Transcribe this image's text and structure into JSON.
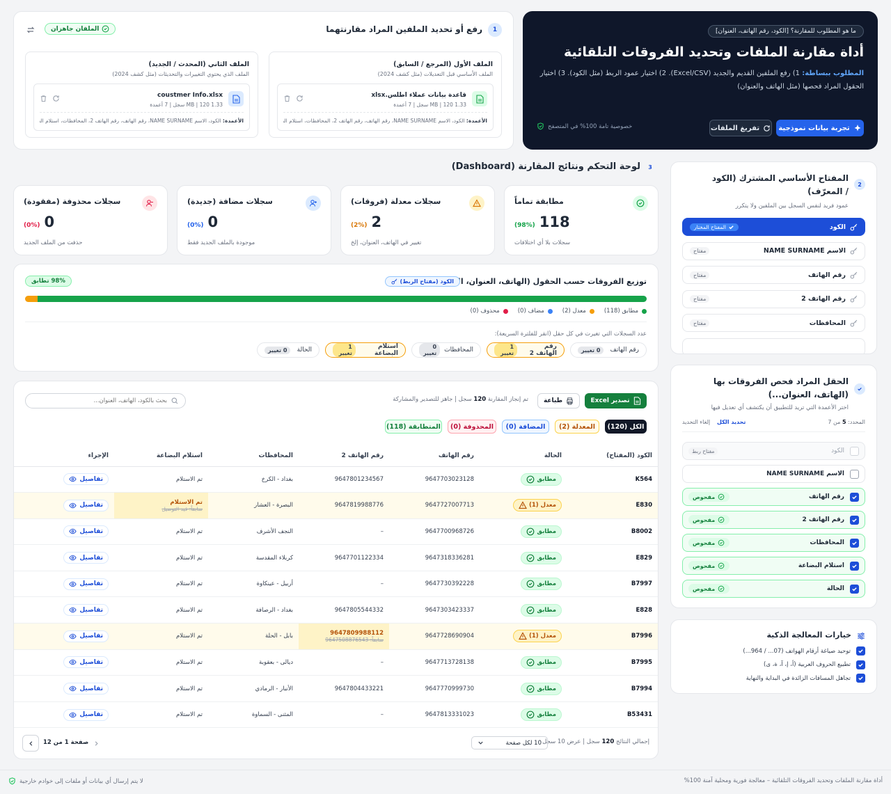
{
  "hero": {
    "question": "ما هو المطلوب للمقارنة؟ [الكود، رقم الهاتف، العنوان]",
    "title": "أداة مقارنة الملفات وتحديد الفروقات التلقائية",
    "desc_strong": "المطلوب ببساطة:",
    "desc": "1) رفع الملفين القديم والجديد (Excel/CSV). 2) اختيار عمود الربط (مثل الكود). 3) اختيار الحقول المراد فحصها (مثل الهاتف والعنوان)",
    "btn_demo": "تجربة بيانات نموذجية",
    "btn_clear": "تفريغ الملفات",
    "privacy": "خصوصية تامة 100% في المتصفح"
  },
  "upload": {
    "step": "1",
    "title": "رفع أو تحديد الملفين المراد مقارنتهما",
    "ready": "الملفان جاهزان",
    "file1": {
      "head": "الملف الأول (المرجع / السابق)",
      "sub": "الملف الأساسي قبل التعديلات (مثل كشف 2024)",
      "name": "قاعدة بيانات عملاء اطلس.xlsx",
      "meta": "1.33 MB | 120 سجل | 7 أعمدة",
      "cols_label": "الأعمدة:",
      "cols": "الكود، الاسم NAME SURNAME، رقم الهاتف، رقم الهاتف 2، المحافظات، استلام الب..."
    },
    "file2": {
      "head": "الملف الثاني (المحدث / الجديد)",
      "sub": "الملف الذي يحتوي التغييرات والتحديثات (مثل كشف 2024)",
      "name": "coustmer Info.xlsx",
      "meta": "1.33 MB | 120 سجل | 7 أعمدة",
      "cols_label": "الأعمدة:",
      "cols": "الكود، الاسم NAME SURNAME، رقم الهاتف، رقم الهاتف 2، المحافظات، استلام الب..."
    }
  },
  "dash": {
    "step": "3",
    "title": "لوحة التحكم ونتائج المقارنة (Dashboard)"
  },
  "stats": [
    {
      "title": "مطابقة تماماً",
      "num": "118",
      "pct": "(98%)",
      "desc": "سجلات بلا أي اختلافات",
      "color": "#16a34a"
    },
    {
      "title": "سجلات معدلة (فروقات)",
      "num": "2",
      "pct": "(2%)",
      "desc": "تغيير في الهاتف، العنوان، إلخ",
      "color": "#d97706"
    },
    {
      "title": "سجلات مضافة (جديدة)",
      "num": "0",
      "pct": "(0%)",
      "desc": "موجودة بالملف الجديد فقط",
      "color": "#2563eb"
    },
    {
      "title": "سجلات محذوفة (مفقودة)",
      "num": "0",
      "pct": "(0%)",
      "desc": "حذفت من الملف الجديد",
      "color": "#e11d48"
    }
  ],
  "dist": {
    "title": "توزيع الفروقات حسب الحقول (الهاتف، العنوان، الأكواد...)",
    "key_badge": "الكود (مفتاح الربط)",
    "match_badge": "98% تطابق",
    "match_frac": 0.98,
    "modified_frac": 0.02,
    "legend": [
      {
        "label": "مطابق (118)",
        "color": "#16a34a"
      },
      {
        "label": "معدل (2)",
        "color": "#f59e0b"
      },
      {
        "label": "مضاف (0)",
        "color": "#3b82f6"
      },
      {
        "label": "محذوف (0)",
        "color": "#e11d48"
      }
    ],
    "note": "عدد السجلات التي تغيرت في كل حقل (انقر للفلترة السريعة):",
    "chips": [
      {
        "label": "رقم الهاتف",
        "count": "0 تغيير",
        "hl": false
      },
      {
        "label": "رقم الهاتف 2",
        "count": "1 تغيير",
        "hl": true
      },
      {
        "label": "المحافظات",
        "count": "0 تغيير",
        "hl": false
      },
      {
        "label": "استلام البضاعة",
        "count": "1 تغيير",
        "hl": true
      },
      {
        "label": "الحالة",
        "count": "0 تغيير",
        "hl": false
      }
    ]
  },
  "table": {
    "export": "تصدير Excel",
    "print": "طباعة",
    "info_a": "تم إنجاز المقارنة",
    "info_n": "120",
    "info_b": "سجل | جاهز للتصدير والمشاركة",
    "search_ph": "بحث بالكود، الهاتف، العنوان...",
    "tabs": [
      {
        "label": "الكل (120)"
      },
      {
        "label": "المعدلة (2)"
      },
      {
        "label": "المضافة (0)"
      },
      {
        "label": "المحذوفة (0)"
      },
      {
        "label": "المتطابقة (118)"
      }
    ],
    "headers": [
      "الكود (المفتاح)",
      "الحالة",
      "رقم الهاتف",
      "رقم الهاتف 2",
      "المحافظات",
      "استلام البضاعة",
      "الإجراء"
    ],
    "rows": [
      {
        "code": "K564",
        "status": "مطابق",
        "s": "ok",
        "phone": "9647703023128",
        "phone2": "9647801234567",
        "gov": "بغداد - الكرخ",
        "recv": "تم الاستلام"
      },
      {
        "code": "E830",
        "status": "معدل (1)",
        "s": "mod",
        "phone": "9647727007713",
        "phone2": "9647819988776",
        "gov": "البصرة - العشار",
        "recv": "تم الاستلام",
        "recv_old": "سابقاً: قيد التوصيل"
      },
      {
        "code": "B8002",
        "status": "مطابق",
        "s": "ok",
        "phone": "9647700968726",
        "phone2": "–",
        "gov": "النجف الأشرف",
        "recv": "تم الاستلام"
      },
      {
        "code": "E829",
        "status": "مطابق",
        "s": "ok",
        "phone": "9647318336281",
        "phone2": "9647701122334",
        "gov": "كربلاء المقدسة",
        "recv": "تم الاستلام"
      },
      {
        "code": "B7997",
        "status": "مطابق",
        "s": "ok",
        "phone": "9647730392228",
        "phone2": "–",
        "gov": "أربيل - عينكاوة",
        "recv": "تم الاستلام"
      },
      {
        "code": "E828",
        "status": "مطابق",
        "s": "ok",
        "phone": "9647303423337",
        "phone2": "9647805544332",
        "gov": "بغداد - الرصافة",
        "recv": "تم الاستلام"
      },
      {
        "code": "B7996",
        "status": "معدل (1)",
        "s": "mod",
        "phone": "9647728690904",
        "phone2": "9647809988112",
        "phone2_old": "سابقاً: 9647508876543",
        "gov": "بابل - الحلة",
        "recv": "تم الاستلام"
      },
      {
        "code": "B7995",
        "status": "مطابق",
        "s": "ok",
        "phone": "9647713728138",
        "phone2": "–",
        "gov": "ديالى - بعقوبة",
        "recv": "تم الاستلام"
      },
      {
        "code": "B7994",
        "status": "مطابق",
        "s": "ok",
        "phone": "9647770999730",
        "phone2": "9647804433221",
        "gov": "الأنبار - الرمادي",
        "recv": "تم الاستلام"
      },
      {
        "code": "B53431",
        "status": "مطابق",
        "s": "ok",
        "phone": "9647813331023",
        "phone2": "–",
        "gov": "المثنى - السماوة",
        "recv": "تم الاستلام"
      }
    ],
    "details": "تفاصيل",
    "footer_total_a": "إجمالي النتائج",
    "footer_total_n": "120",
    "footer_total_b": "سجل | عرض 10 سجل",
    "per_page": "10 لكل صفحة",
    "page": "صفحة 1 من 12"
  },
  "keypanel": {
    "step": "2",
    "title": "المفتاح الأساسي المشترك (الكود / المعرّف)",
    "sub": "عمود فريد لنفس السجل بين الملفين ولا يتكرر",
    "selected_badge": "المفتاح المختار",
    "key_tag": "مفتاح",
    "items": [
      "الكود",
      "الاسم NAME SURNAME",
      "رقم الهاتف",
      "رقم الهاتف 2",
      "المحافظات"
    ]
  },
  "fieldpanel": {
    "title": "الحقل المراد فحص الفروقات بها (الهاتف، العنوان...)",
    "sub": "اختر الأعمدة التي تريد للتطبيق أن يكتشف أي تعديل فيها",
    "count_a": "المحدد:",
    "count_n": "5",
    "count_b": "من 7",
    "select_all": "تحديد الكل",
    "clear": "إلغاء التحديد",
    "key_tag": "مفتاح ربط",
    "checked_tag": "مفحوص",
    "items": [
      {
        "label": "الكود",
        "state": "key"
      },
      {
        "label": "الاسم NAME SURNAME",
        "state": "off"
      },
      {
        "label": "رقم الهاتف",
        "state": "on"
      },
      {
        "label": "رقم الهاتف 2",
        "state": "on"
      },
      {
        "label": "المحافظات",
        "state": "on"
      },
      {
        "label": "استلام البضاعة",
        "state": "on"
      },
      {
        "label": "الحالة",
        "state": "on"
      }
    ]
  },
  "options": {
    "title": "خيارات المعالجة الذكية",
    "items": [
      "توحيد صياغة أرقام الهواتف (07... / 964...)",
      "تطبيع الحروف العربية (أ، إ، آ، ة، ى)",
      "تجاهل المسافات الزائدة في البداية والنهاية"
    ]
  },
  "footer": {
    "left": "أداة مقارنة الملفات وتحديد الفروقات التلقائية – معالجة فورية ومحلية آمنة 100%",
    "right": "لا يتم إرسال أي بيانات أو ملفات إلى خوادم خارجية"
  }
}
